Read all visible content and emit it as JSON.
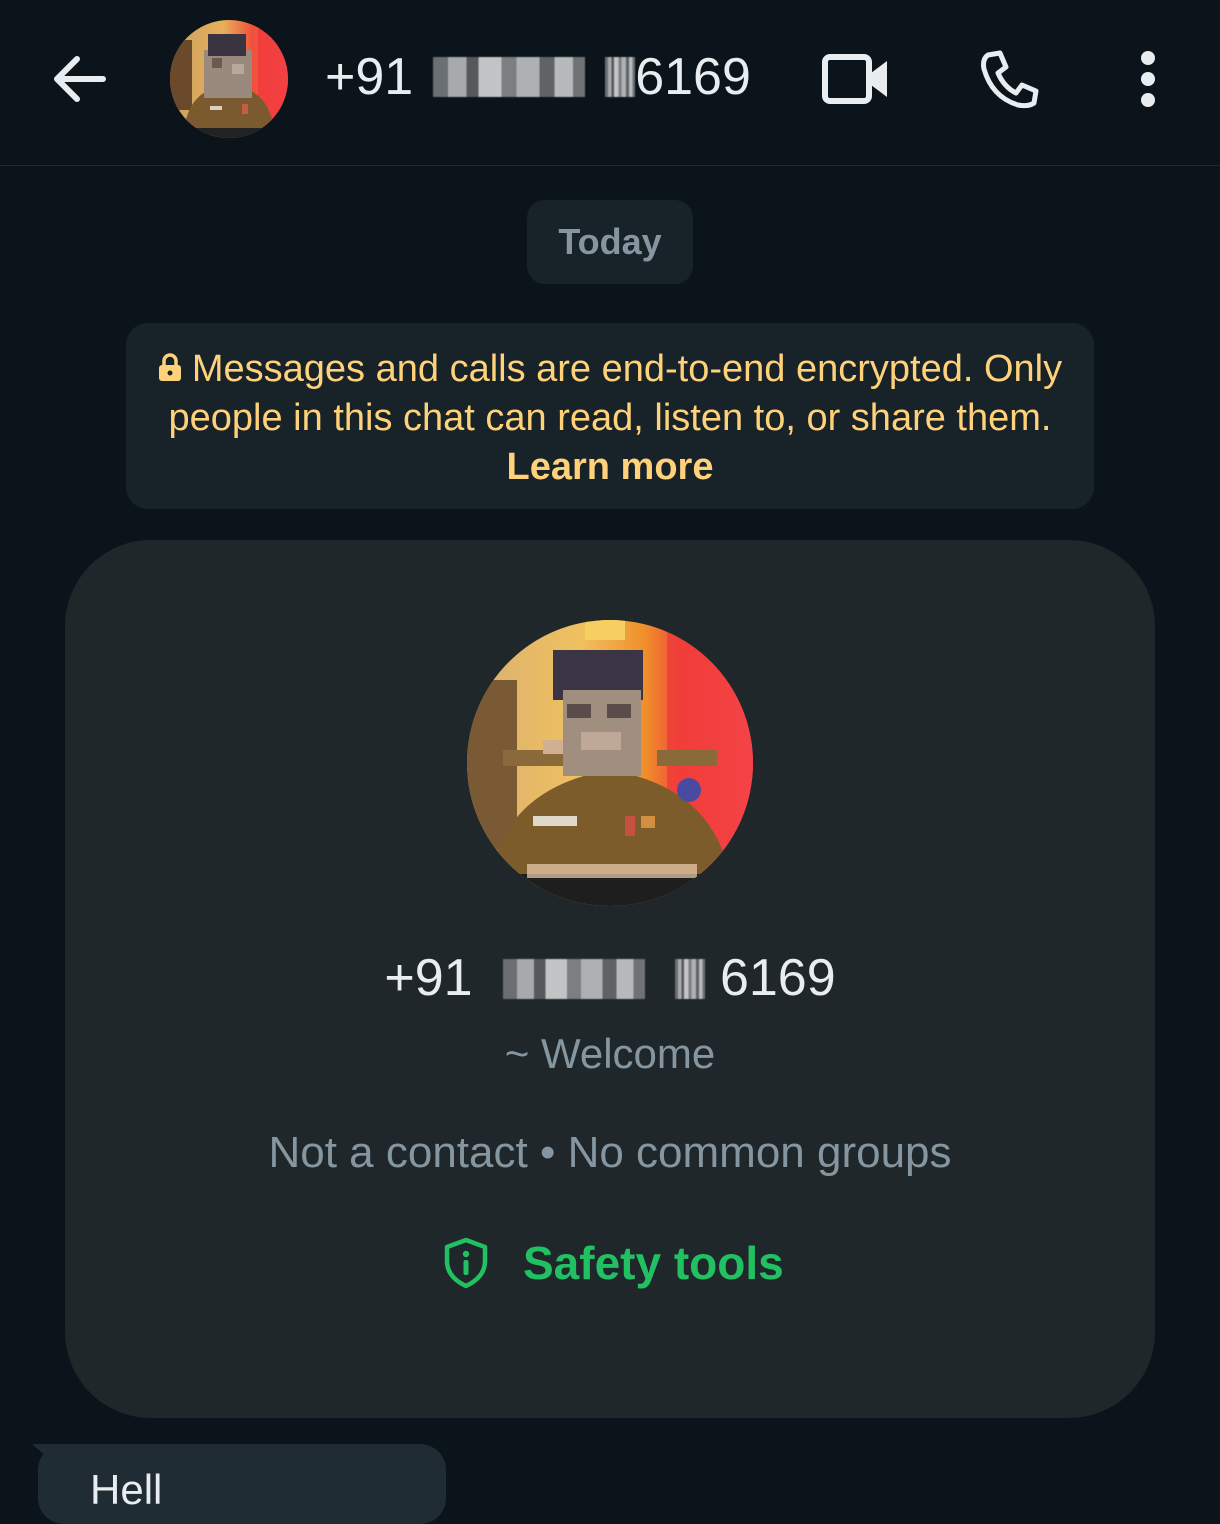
{
  "header": {
    "phone_prefix": "+91",
    "phone_suffix": "6169",
    "back_icon": "arrow-left-icon",
    "video_icon": "video-camera-icon",
    "call_icon": "phone-icon",
    "menu_icon": "more-vertical-icon"
  },
  "date_chip": "Today",
  "encryption_notice": {
    "text": "Messages and calls are end-to-end encrypted. Only people in this chat can read, listen to, or share them.",
    "link": "Learn more",
    "icon": "lock-icon"
  },
  "profile_card": {
    "phone_prefix": "+91",
    "phone_suffix": "6169",
    "about": "~ Welcome",
    "meta": "Not a contact • No common groups",
    "safety_label": "Safety tools",
    "safety_icon": "shield-info-icon"
  },
  "message_preview": {
    "text": "Hell"
  },
  "colors": {
    "background": "#0b141a",
    "card": "#1f272a",
    "notice_text": "#ffd279",
    "accent_green": "#21c063",
    "muted": "#8696a0"
  }
}
